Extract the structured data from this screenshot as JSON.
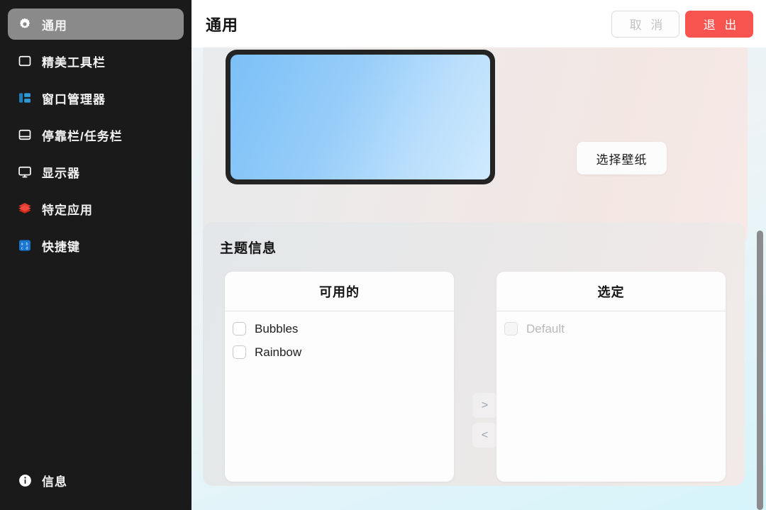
{
  "sidebar": {
    "items": [
      {
        "label": "通用",
        "icon": "gear-icon",
        "key": "general",
        "active": true
      },
      {
        "label": "精美工具栏",
        "icon": "toolbar-icon",
        "key": "toolbar",
        "active": false
      },
      {
        "label": "窗口管理器",
        "icon": "window-manager-icon",
        "key": "wm",
        "active": false
      },
      {
        "label": "停靠栏/任务栏",
        "icon": "dock-taskbar-icon",
        "key": "dock",
        "active": false
      },
      {
        "label": "显示器",
        "icon": "monitor-icon",
        "key": "display",
        "active": false
      },
      {
        "label": "特定应用",
        "icon": "layers-icon",
        "key": "apps",
        "active": false
      },
      {
        "label": "快捷键",
        "icon": "keyboard-abcd-icon",
        "key": "shortcuts",
        "active": false
      }
    ],
    "info": {
      "label": "信息",
      "icon": "info-circle-icon"
    }
  },
  "header": {
    "title": "通用",
    "cancel_label": "取 消",
    "exit_label": "退 出"
  },
  "wallpaper": {
    "choose_label": "选择壁纸",
    "preview_icon": "monitor-preview"
  },
  "theme": {
    "section_title": "主题信息",
    "available": {
      "header": "可用的",
      "items": [
        {
          "label": "Bubbles",
          "checked": false,
          "disabled": false
        },
        {
          "label": "Rainbow",
          "checked": false,
          "disabled": false
        }
      ]
    },
    "selected": {
      "header": "选定",
      "items": [
        {
          "label": "Default",
          "checked": false,
          "disabled": true
        }
      ]
    },
    "move_right_label": ">",
    "move_left_label": "<"
  },
  "colors": {
    "sidebar_bg": "#1a1a1a",
    "sidebar_active": "#8a8a8a",
    "exit_red": "#f7534f",
    "wm_icon_blue": "#1f7fc0",
    "layers_icon_red": "#e23b2e",
    "keyboard_icon_blue": "#1876d2",
    "scrollbar_thumb": "#8c8c8c"
  }
}
